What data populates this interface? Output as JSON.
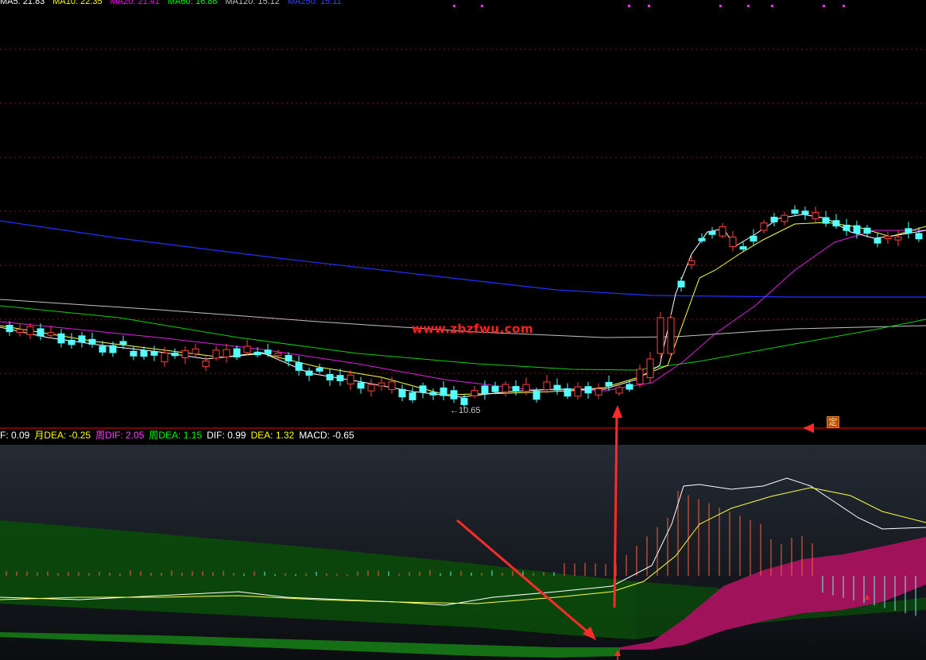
{
  "price_panel": {
    "ma_legend": [
      {
        "text": "MA5: 21.83",
        "color": "#ffffff"
      },
      {
        "text": "MA10: 22.35",
        "color": "#ffff00"
      },
      {
        "text": "MA20: 21.41",
        "color": "#ff00ff"
      },
      {
        "text": "MA60: 16.88",
        "color": "#00ff00"
      },
      {
        "text": "MA120: 15.12",
        "color": "#c0c0c0"
      },
      {
        "text": "MA250: 15.11",
        "color": "#3040ff"
      }
    ],
    "low_marker": "←10.65",
    "watermark": "www.zbzfwu.com",
    "ding_badge": "定"
  },
  "indicator_panel": {
    "legend": [
      {
        "text": "F: 0.09",
        "color": "#ffffff"
      },
      {
        "text": "月DEA: -0.25",
        "color": "#ffff00"
      },
      {
        "text": "周DIF: 2.05",
        "color": "#ff40ff"
      },
      {
        "text": "周DEA: 1.15",
        "color": "#00ff00"
      },
      {
        "text": "DIF: 0.99",
        "color": "#ffffff"
      },
      {
        "text": "DEA: 1.32",
        "color": "#ffff00"
      },
      {
        "text": "MACD: -0.65",
        "color": "#ffffff"
      }
    ]
  },
  "colors": {
    "up_candle": "#ff4040",
    "down_candle": "#54ffff",
    "grid": "#8a1010",
    "divider": "#c00000",
    "ma250": "#2030ff",
    "ma120": "#c0c0c0",
    "ma60": "#10d010",
    "ma20": "#e020e0",
    "ma10": "#ffff40",
    "ma5": "#ffffff",
    "weekly_fill_pos": "#a0125a",
    "weekly_fill_neg": "#0a4a0a",
    "arrow": "#ff2a2a"
  }
}
